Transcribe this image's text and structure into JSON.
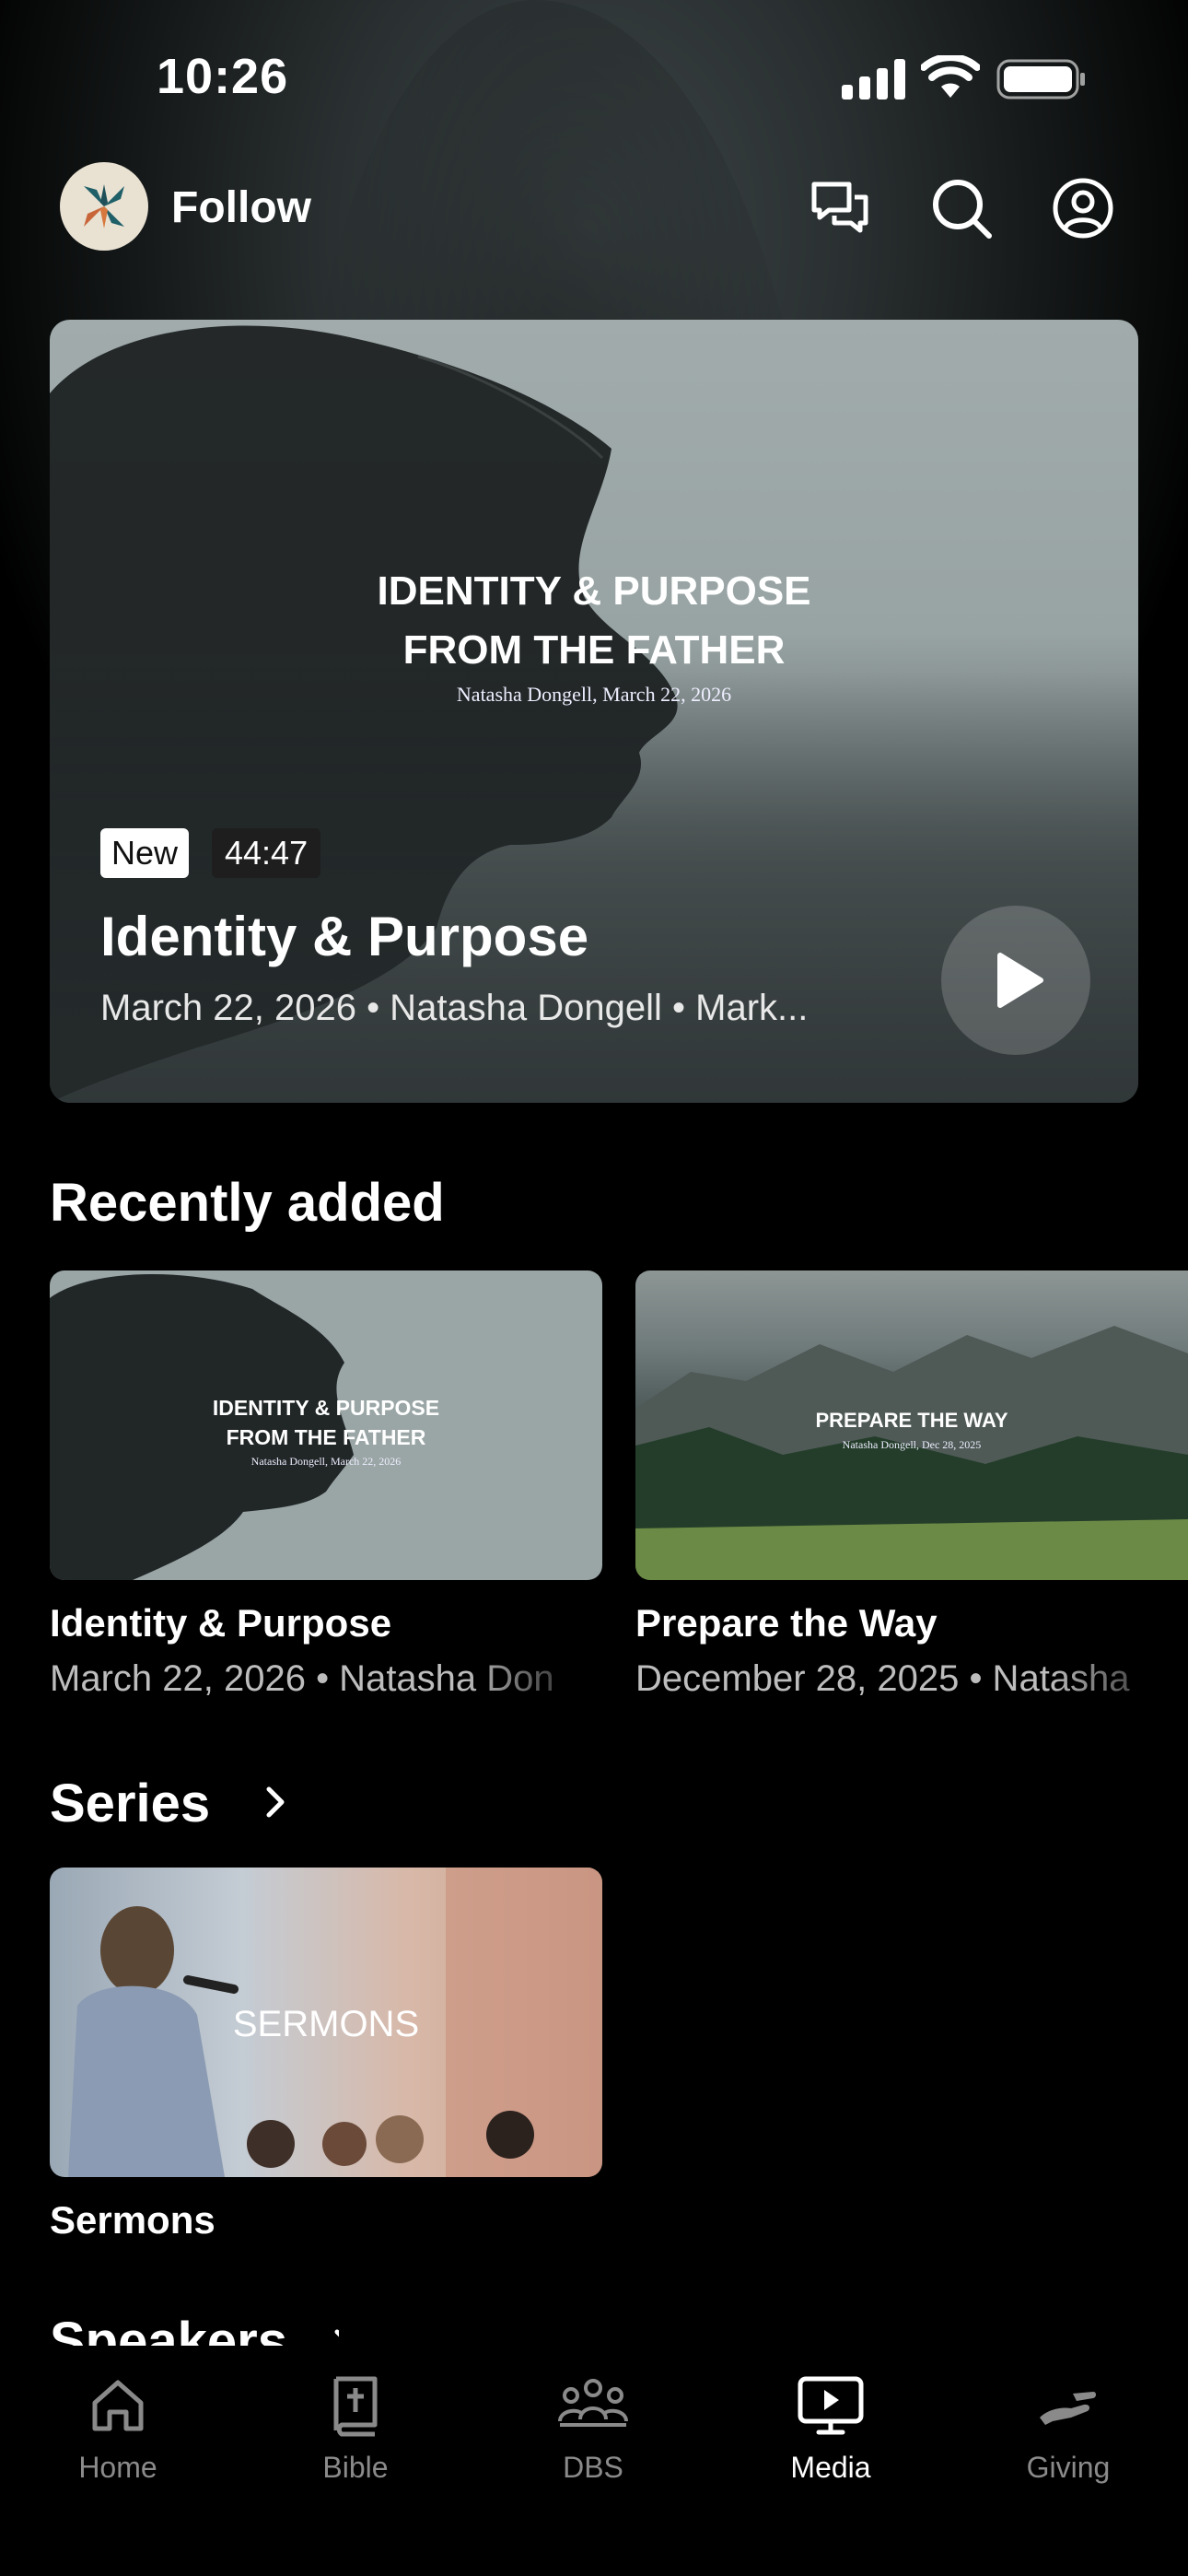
{
  "status_bar": {
    "time": "10:26"
  },
  "header": {
    "brand": "Follow"
  },
  "hero": {
    "art_title_line1": "IDENTITY & PURPOSE",
    "art_title_line2": "FROM THE FATHER",
    "art_subtitle": "Natasha Dongell, March 22, 2026",
    "badge_new": "New",
    "duration": "44:47",
    "title": "Identity & Purpose",
    "meta": "March 22, 2026 • Natasha Dongell • Mark..."
  },
  "recently_added": {
    "title": "Recently added",
    "items": [
      {
        "art_line1": "IDENTITY & PURPOSE",
        "art_line2": "FROM THE FATHER",
        "art_sub": "Natasha Dongell, March 22, 2026",
        "title": "Identity & Purpose",
        "meta": "March 22, 2026 • Natasha Don"
      },
      {
        "art_line1": "PREPARE THE WAY",
        "art_sub": "Natasha Dongell, Dec 28, 2025",
        "title": "Prepare the Way",
        "meta": "December 28, 2025 • Natasha"
      }
    ]
  },
  "series": {
    "title": "Series",
    "items": [
      {
        "art_label": "SERMONS",
        "title": "Sermons"
      }
    ]
  },
  "speakers": {
    "title": "Speakers"
  },
  "tabbar": {
    "tabs": [
      {
        "label": "Home",
        "icon": "home-icon"
      },
      {
        "label": "Bible",
        "icon": "bible-icon"
      },
      {
        "label": "DBS",
        "icon": "group-icon"
      },
      {
        "label": "Media",
        "icon": "media-icon",
        "active": true
      },
      {
        "label": "Giving",
        "icon": "giving-icon"
      }
    ]
  },
  "colors": {
    "background": "#000000",
    "text": "#ffffff",
    "muted": "#8a8a8a",
    "logo_bg": "#e9e2d3"
  }
}
